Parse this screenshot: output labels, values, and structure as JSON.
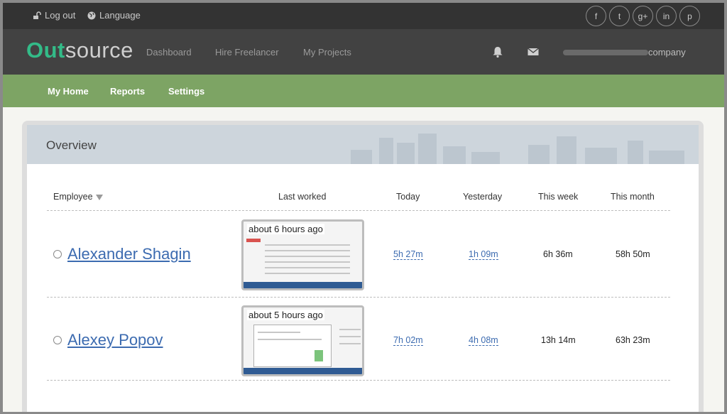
{
  "topbar": {
    "logout_label": "Log out",
    "language_label": "Language",
    "socials": [
      "f",
      "t",
      "g+",
      "in",
      "p"
    ]
  },
  "header": {
    "logo_part1": "Out",
    "logo_part2": "source",
    "nav": [
      "Dashboard",
      "Hire Freelancer",
      "My Projects"
    ],
    "account_suffix": "company",
    "icons": [
      "bell-icon",
      "envelope-icon"
    ]
  },
  "subnav": {
    "items": [
      "My Home",
      "Reports",
      "Settings"
    ],
    "active": "My Home"
  },
  "overview": {
    "title": "Overview",
    "columns": {
      "employee": "Employee",
      "last_worked": "Last worked",
      "today": "Today",
      "yesterday": "Yesterday",
      "this_week": "This week",
      "this_month": "This month"
    },
    "rows": [
      {
        "name": "Alexander Shagin",
        "last_worked": "about 6 hours ago",
        "today": "5h 27m",
        "yesterday": "1h 09m",
        "this_week": "6h 36m",
        "this_month": "58h 50m"
      },
      {
        "name": "Alexey Popov",
        "last_worked": "about 5 hours ago",
        "today": "7h 02m",
        "yesterday": "4h 08m",
        "this_week": "13h 14m",
        "this_month": "63h 23m"
      }
    ]
  },
  "colors": {
    "brand_green": "#33bb88",
    "subnav_green": "#7da464",
    "link_blue": "#3c6bb0",
    "header_dark": "#424242"
  }
}
